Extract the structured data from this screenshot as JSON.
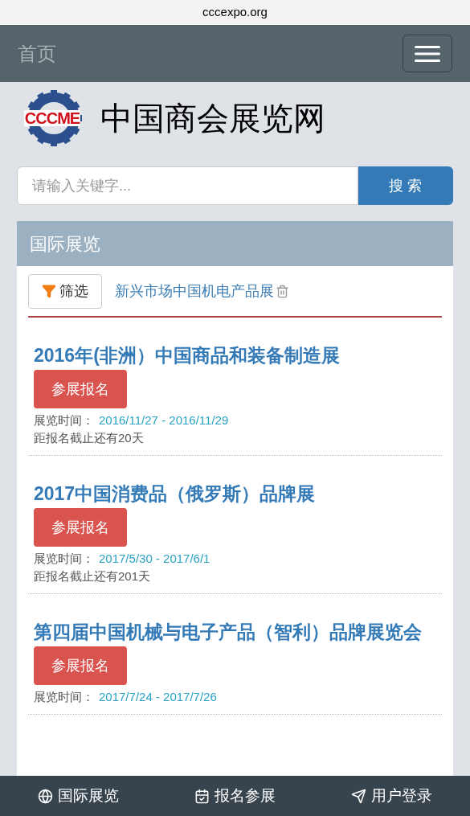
{
  "browser": {
    "url": "cccexpo.org"
  },
  "navbar": {
    "title": "首页"
  },
  "logo": {
    "mark": "CCCME",
    "title": "中国商会展览网"
  },
  "search": {
    "placeholder": "请输入关键字...",
    "button": "搜 索"
  },
  "panel": {
    "title": "国际展览",
    "filter_button": "筛选",
    "filter_tag": "新兴市场中国机电产品展",
    "items": [
      {
        "title": "2016年(非洲）中国商品和装备制造展",
        "button": "参展报名",
        "time_label": "展览时间：",
        "dates": "2016/11/27 - 2016/11/29",
        "deadline": "距报名截止还有20天"
      },
      {
        "title": "2017中国消费品（俄罗斯）品牌展",
        "button": "参展报名",
        "time_label": "展览时间：",
        "dates": "2017/5/30 - 2017/6/1",
        "deadline": "距报名截止还有201天"
      },
      {
        "title": "第四届中国机械与电子产品（智利）品牌展览会",
        "button": "参展报名",
        "time_label": "展览时间：",
        "dates": "2017/7/24 - 2017/7/26"
      }
    ]
  },
  "bottom_nav": [
    {
      "kind": "globe",
      "label": "国际展览"
    },
    {
      "kind": "calendar",
      "label": "报名参展"
    },
    {
      "kind": "send",
      "label": "用户登录"
    }
  ]
}
